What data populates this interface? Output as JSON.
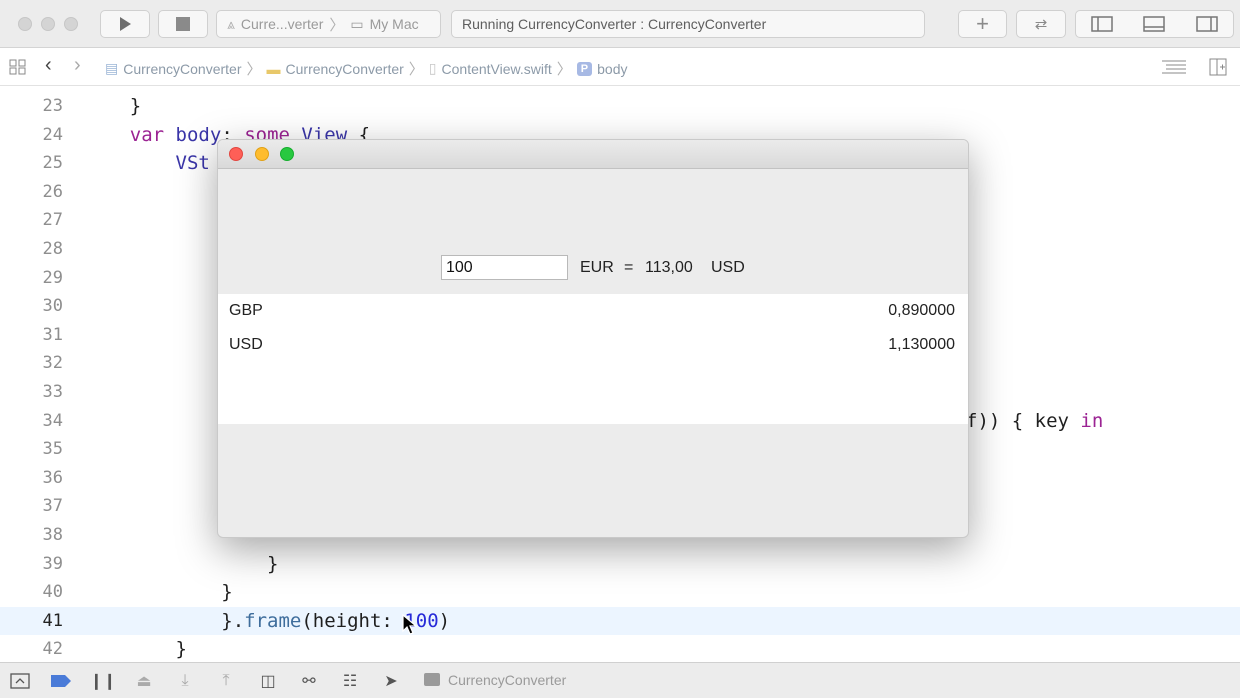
{
  "toolbar": {
    "scheme_target": "Curre...verter",
    "destination": "My Mac",
    "activity": "Running CurrencyConverter : CurrencyConverter"
  },
  "jumpbar": {
    "crumbs": [
      "CurrencyConverter",
      "CurrencyConverter",
      "ContentView.swift",
      "body"
    ],
    "symbol_badge": "P"
  },
  "editor": {
    "current_line": "41",
    "lines": [
      {
        "n": "23",
        "code": "    }"
      },
      {
        "n": "24",
        "code": "    var body: some View {"
      },
      {
        "n": "25",
        "code": "        VSt"
      },
      {
        "n": "26",
        "code": ""
      },
      {
        "n": "27",
        "code": ""
      },
      {
        "n": "28",
        "code": ""
      },
      {
        "n": "29",
        "code": ""
      },
      {
        "n": "30",
        "code": ""
      },
      {
        "n": "31",
        "code": ""
      },
      {
        "n": "32",
        "code": ""
      },
      {
        "n": "33",
        "code": ""
      },
      {
        "n": "34",
        "code": "f)) { key in"
      },
      {
        "n": "35",
        "code": ""
      },
      {
        "n": "36",
        "code": ""
      },
      {
        "n": "37",
        "code": ""
      },
      {
        "n": "38",
        "code": ""
      },
      {
        "n": "39",
        "code": "                }"
      },
      {
        "n": "40",
        "code": "            }"
      },
      {
        "n": "41",
        "code": "            }.frame(height: 100)"
      },
      {
        "n": "42",
        "code": "        }"
      }
    ]
  },
  "app": {
    "amount_value": "100",
    "base_currency": "EUR",
    "equals": "=",
    "result": "113,00",
    "target_currency": "USD",
    "rates": [
      {
        "currency": "GBP",
        "rate": "0,890000"
      },
      {
        "currency": "USD",
        "rate": "1,130000"
      }
    ]
  },
  "bottombar": {
    "target": "CurrencyConverter"
  },
  "colors": {
    "keyword": "#9b2393",
    "type": "#3a35a8",
    "number": "#272ad8",
    "close": "#fe5f57",
    "minimize": "#febc2e",
    "zoom": "#28c840",
    "breakpoint_active": "#4a7bd8"
  }
}
